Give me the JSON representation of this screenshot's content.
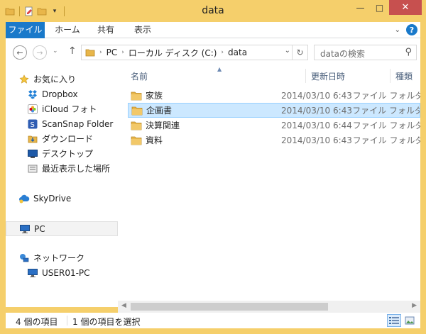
{
  "window": {
    "title": "data",
    "controls": {
      "minimize": "—",
      "maximize": "□",
      "close": "✕"
    }
  },
  "ribbon": {
    "tabs": [
      "ファイル",
      "ホーム",
      "共有",
      "表示"
    ],
    "help": "?"
  },
  "nav": {
    "address": [
      "PC",
      "ローカル ディスク (C:)",
      "data"
    ],
    "search_placeholder": "dataの検索"
  },
  "sidebar": {
    "favorites_label": "お気に入り",
    "favorites": [
      "Dropbox",
      "iCloud フォト",
      "ScanSnap Folder",
      "ダウンロード",
      "デスクトップ",
      "最近表示した場所"
    ],
    "skydrive": "SkyDrive",
    "pc": "PC",
    "network": "ネットワーク",
    "network_items": [
      "USER01-PC"
    ]
  },
  "files": {
    "columns": [
      "名前",
      "更新日時",
      "種類"
    ],
    "rows": [
      {
        "name": "家族",
        "date": "2014/03/10 6:43",
        "type": "ファイル フォルダー"
      },
      {
        "name": "企画書",
        "date": "2014/03/10 6:43",
        "type": "ファイル フォルダー"
      },
      {
        "name": "決算関連",
        "date": "2014/03/10 6:44",
        "type": "ファイル フォルダー"
      },
      {
        "name": "資料",
        "date": "2014/03/10 6:43",
        "type": "ファイル フォルダー"
      }
    ],
    "selected_index": 1
  },
  "status": {
    "item_count": "4 個の項目",
    "selection": "1 個の項目を選択"
  },
  "colors": {
    "accent": "#1979ca",
    "frame": "#f5cf6b",
    "selection": "#cce8ff",
    "folder": "#e8b64a"
  }
}
